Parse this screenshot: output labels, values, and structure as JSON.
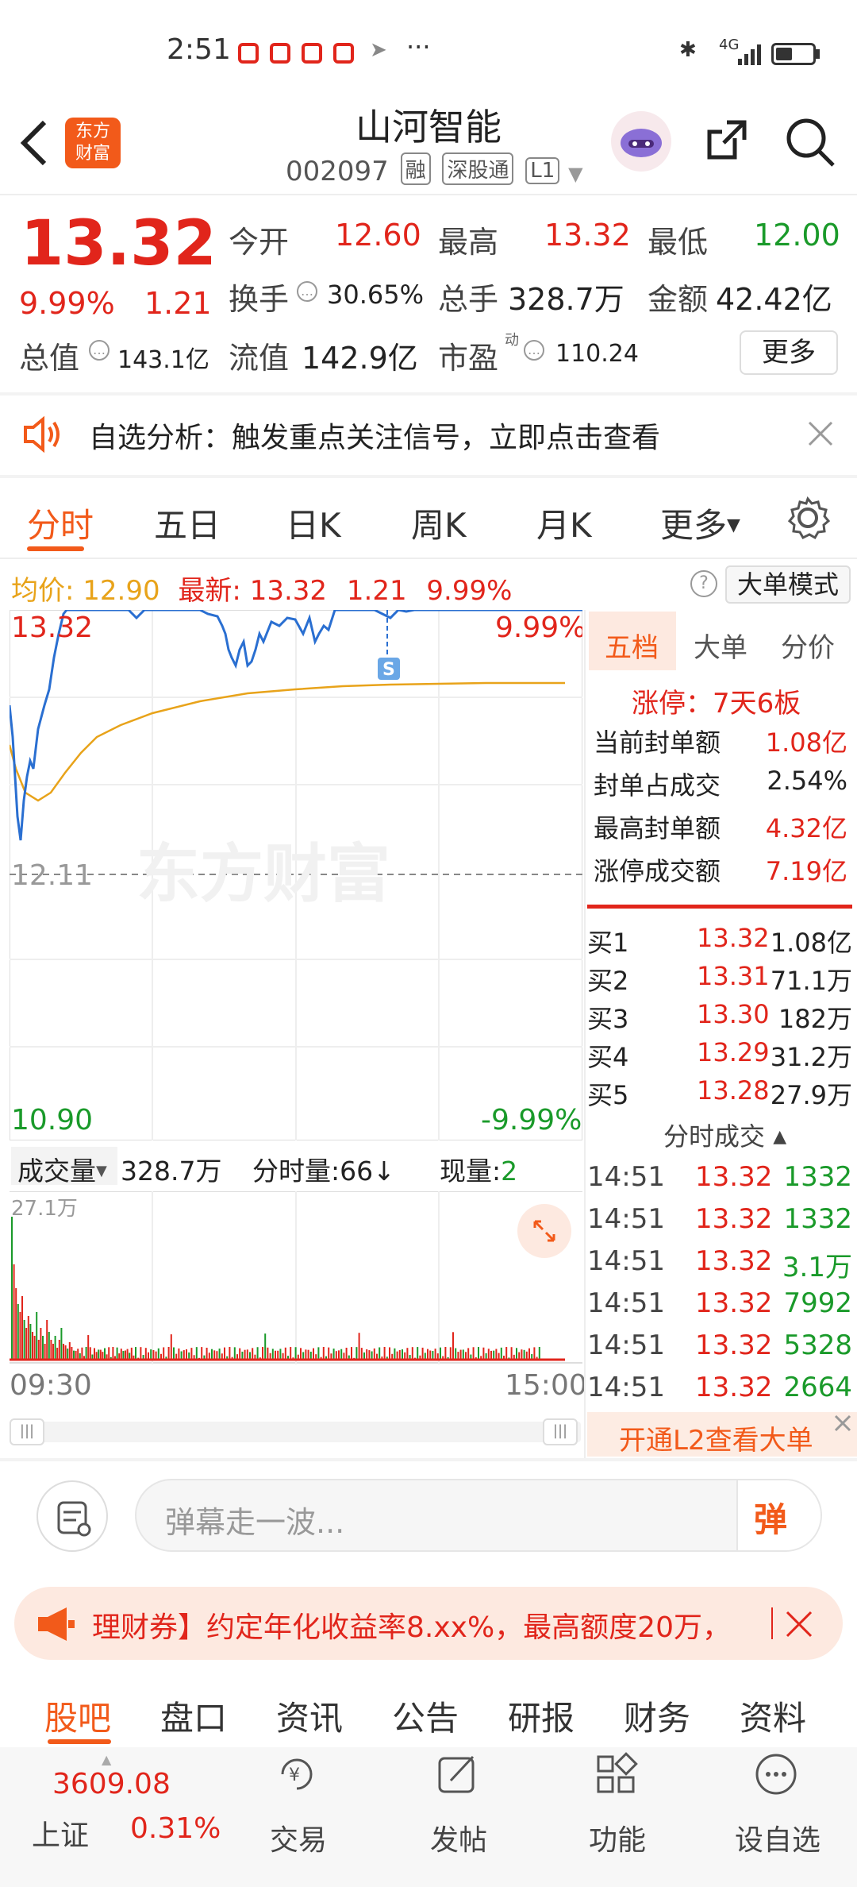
{
  "status_bar": {
    "time": "2:51",
    "dots": "···",
    "network": "4G"
  },
  "header": {
    "title": "山河智能",
    "code": "002097",
    "tags": [
      "融",
      "深股通",
      "L1"
    ],
    "logo_line1": "东方",
    "logo_line2": "财富"
  },
  "quote": {
    "price": "13.32",
    "change_pct": "9.99%",
    "change": "1.21",
    "open_label": "今开",
    "open": "12.60",
    "high_label": "最高",
    "high": "13.32",
    "low_label": "最低",
    "low": "12.00",
    "turnover_label": "换手",
    "turnover": "30.65%",
    "volume_label": "总手",
    "volume": "328.7万",
    "amount_label": "金额",
    "amount": "42.42亿",
    "mktcap_label": "总值",
    "mktcap": "143.1亿",
    "float_label": "流值",
    "float": "142.9亿",
    "pe_label": "市盈",
    "pe_sup": "动",
    "pe": "110.24",
    "more": "更多"
  },
  "alert": {
    "text": "自选分析：触发重点关注信号，立即点击查看"
  },
  "tabs": [
    "分时",
    "五日",
    "日K",
    "周K",
    "月K",
    "更多"
  ],
  "avg_line": {
    "avg_label": "均价:",
    "avg": "12.90",
    "latest_label": "最新:",
    "latest": "13.32",
    "chg": "1.21",
    "pct": "9.99%",
    "mode": "大单模式"
  },
  "chart": {
    "upper": "13.32",
    "upper_pct": "9.99%",
    "mid": "12.11",
    "lower": "10.90",
    "lower_pct": "-9.99%",
    "watermark": "东方财富",
    "marker": "S",
    "volume_label": "成交量",
    "volume": "328.7万",
    "tick_vol_label": "分时量:66",
    "arrow": "↓",
    "now_vol_label": "现量:",
    "now_vol": "2",
    "max_vol": "27.1万",
    "time_start": "09:30",
    "time_end": "15:00"
  },
  "right_panel": {
    "tabs": [
      "五档",
      "大单",
      "分价"
    ],
    "limit_title": "涨停：7天6板",
    "seal": [
      {
        "label": "当前封单额",
        "value": "1.08亿"
      },
      {
        "label": "封单占成交",
        "value": "2.54%"
      },
      {
        "label": "最高封单额",
        "value": "4.32亿"
      },
      {
        "label": "涨停成交额",
        "value": "7.19亿"
      }
    ],
    "bids": [
      {
        "label": "买1",
        "price": "13.32",
        "vol": "1.08亿"
      },
      {
        "label": "买2",
        "price": "13.31",
        "vol": "71.1万"
      },
      {
        "label": "买3",
        "price": "13.30",
        "vol": "182万"
      },
      {
        "label": "买4",
        "price": "13.29",
        "vol": "31.2万"
      },
      {
        "label": "买5",
        "price": "13.28",
        "vol": "27.9万"
      }
    ],
    "ticks_title": "分时成交",
    "ticks": [
      {
        "time": "14:51",
        "price": "13.32",
        "vol": "1332"
      },
      {
        "time": "14:51",
        "price": "13.32",
        "vol": "1332"
      },
      {
        "time": "14:51",
        "price": "13.32",
        "vol": "3.1万"
      },
      {
        "time": "14:51",
        "price": "13.32",
        "vol": "7992"
      },
      {
        "time": "14:51",
        "price": "13.32",
        "vol": "5328"
      },
      {
        "time": "14:51",
        "price": "13.32",
        "vol": "2664"
      }
    ],
    "l2": "开通L2查看大单"
  },
  "danmaku": {
    "placeholder": "弹幕走一波...",
    "button": "弹"
  },
  "ad": {
    "text": "理财券】约定年化收益率8.xx%，最高额度20万，"
  },
  "bottom_tabs": [
    "股吧",
    "盘口",
    "资讯",
    "公告",
    "研报",
    "财务",
    "资料"
  ],
  "bottom_nav": {
    "index_value": "3609.08",
    "index_name": "上证",
    "index_pct": "0.31%",
    "items": [
      "交易",
      "发帖",
      "功能",
      "设自选"
    ]
  }
}
